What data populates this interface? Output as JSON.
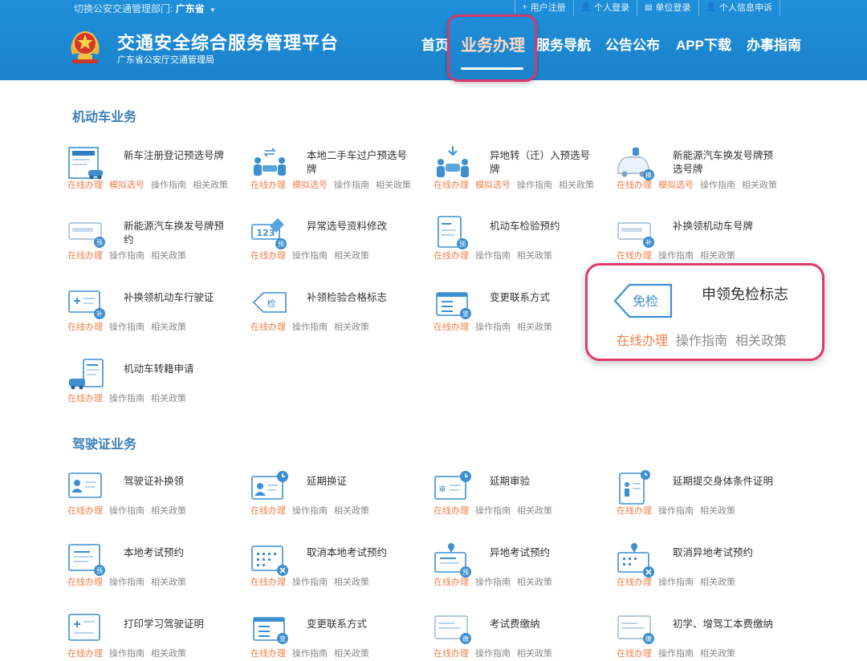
{
  "header": {
    "region_prefix": "切换公安交通管理部门:",
    "region_value": "广东省",
    "top_links": [
      {
        "icon": "plus-icon",
        "glyph": "+",
        "label": "用户注册"
      },
      {
        "icon": "person-icon",
        "glyph": "👤",
        "label": "个人登录"
      },
      {
        "icon": "building-icon",
        "glyph": "▤",
        "label": "单位登录"
      },
      {
        "icon": "person-icon",
        "glyph": "👤",
        "label": "个人信息申诉"
      }
    ],
    "title": "交通安全综合服务管理平台",
    "subtitle": "广东省公安厅交通管理局",
    "nav": [
      {
        "label": "首页"
      },
      {
        "label": "业务办理",
        "active": true
      },
      {
        "label": "服务导航"
      },
      {
        "label": "公告公布"
      },
      {
        "label": "APP下载"
      },
      {
        "label": "办事指南"
      }
    ]
  },
  "common": {
    "online": "在线办理",
    "mock": "模拟选号",
    "guide": "操作指南",
    "policy": "相关政策"
  },
  "sections": [
    {
      "title": "机动车业务",
      "items": [
        {
          "name": "新车注册登记预选号牌",
          "icon": "new-car-plate-icon",
          "mock": true
        },
        {
          "name": "本地二手车过户预选号牌",
          "icon": "car-transfer-icon",
          "mock": true
        },
        {
          "name": "异地转（迁）入预选号牌",
          "icon": "car-relocate-icon",
          "mock": true
        },
        {
          "name": "新能源汽车换发号牌预选号牌",
          "icon": "ev-plate-icon",
          "mock": true
        },
        {
          "name": "新能源汽车换发号牌预约",
          "icon": "ev-plate-appointment-icon",
          "badge": "预"
        },
        {
          "name": "异常选号资料修改",
          "icon": "plate-number-edit-icon",
          "badge": "预"
        },
        {
          "name": "机动车检验预约",
          "icon": "inspection-appointment-icon",
          "badge": "预"
        },
        {
          "name": "补换领机动车号牌",
          "icon": "plate-reissue-icon",
          "badge": "补"
        },
        {
          "name": "补换领机动车行驶证",
          "icon": "license-reissue-icon",
          "badge": "补"
        },
        {
          "name": "补领检验合格标志",
          "icon": "inspection-mark-icon",
          "badge": "检"
        },
        {
          "name": "变更联系方式",
          "icon": "contact-change-icon",
          "badge": "变"
        },
        {
          "name": "申领免检标志",
          "icon": "exempt-mark-icon",
          "badge": "免检",
          "highlighted": true
        },
        {
          "name": "机动车转籍申请",
          "icon": "vehicle-transfer-icon"
        }
      ]
    },
    {
      "title": "驾驶证业务",
      "items": [
        {
          "name": "驾驶证补换领",
          "icon": "driver-license-icon"
        },
        {
          "name": "延期换证",
          "icon": "extend-renewal-icon"
        },
        {
          "name": "延期审验",
          "icon": "extend-review-icon",
          "badge": "审"
        },
        {
          "name": "延期提交身体条件证明",
          "icon": "health-proof-icon"
        },
        {
          "name": "本地考试预约",
          "icon": "local-exam-icon",
          "badge": "预"
        },
        {
          "name": "取消本地考试预约",
          "icon": "cancel-local-exam-icon"
        },
        {
          "name": "异地考试预约",
          "icon": "remote-exam-icon",
          "badge": "预"
        },
        {
          "name": "取消异地考试预约",
          "icon": "cancel-remote-exam-icon"
        },
        {
          "name": "打印学习驾驶证明",
          "icon": "print-learner-icon"
        },
        {
          "name": "变更联系方式",
          "icon": "contact-change-icon",
          "badge": "变"
        },
        {
          "name": "考试费缴纳",
          "icon": "exam-fee-icon",
          "badge": "缴"
        },
        {
          "name": "初学、增驾工本费缴纳",
          "icon": "learner-fee-icon",
          "badge": "缴"
        }
      ]
    }
  ],
  "colors": {
    "header_blue": "#1f8fd9",
    "accent_orange": "#f0804a",
    "highlight_pink": "#e03a6a",
    "section_blue": "#3b7fb5"
  }
}
